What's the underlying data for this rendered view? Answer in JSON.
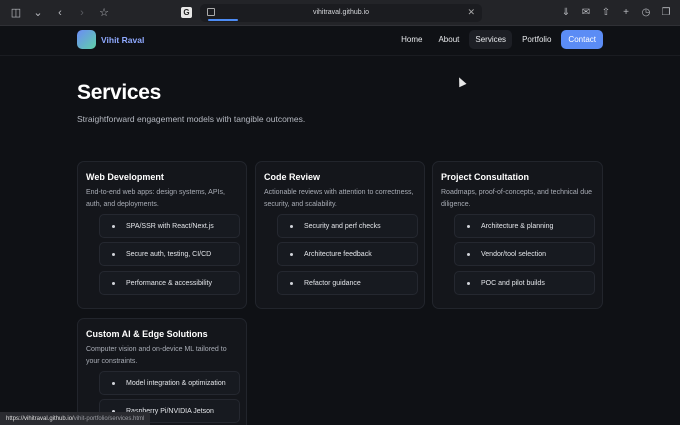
{
  "browser": {
    "url": "vihitraval.github.io",
    "tab_favicon": "G"
  },
  "header": {
    "brand": "Vihit Raval",
    "nav": [
      "Home",
      "About",
      "Services",
      "Portfolio"
    ],
    "contact": "Contact"
  },
  "main": {
    "title": "Services",
    "subtitle": "Straightforward engagement models with tangible outcomes."
  },
  "cards": [
    {
      "title": "Web Development",
      "desc": "End-to-end web apps: design systems, APIs, auth, and deployments.",
      "items": [
        "SPA/SSR with React/Next.js",
        "Secure auth, testing, CI/CD",
        "Performance & accessibility"
      ]
    },
    {
      "title": "Code Review",
      "desc": "Actionable reviews with attention to correctness, security, and scalability.",
      "items": [
        "Security and perf checks",
        "Architecture feedback",
        "Refactor guidance"
      ]
    },
    {
      "title": "Project Consultation",
      "desc": "Roadmaps, proof-of-concepts, and technical due diligence.",
      "items": [
        "Architecture & planning",
        "Vendor/tool selection",
        "POC and pilot builds"
      ]
    },
    {
      "title": "Custom AI & Edge Solutions",
      "desc": "Computer vision and on-device ML tailored to your constraints.",
      "items": [
        "Model integration & optimization",
        "Raspberry Pi/NVIDIA Jetson"
      ]
    }
  ],
  "status_bar": {
    "host": "https://vihitraval.github.io/",
    "path": "vihit-portfolio/services.html"
  },
  "colors": {
    "accent": "#5b8cf5",
    "background": "#0f1115",
    "card": "#14161b"
  }
}
